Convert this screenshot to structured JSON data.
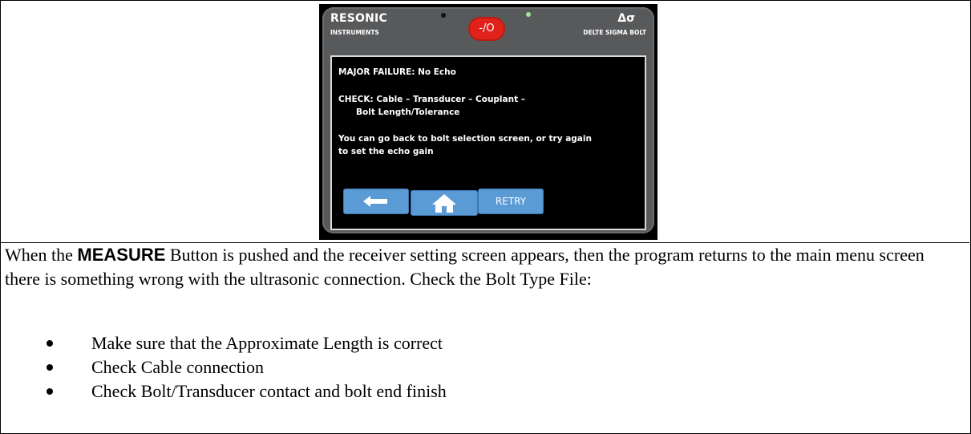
{
  "device": {
    "brand_name": "RESONIC",
    "brand_sub": "INSTRUMENTS",
    "model_symbol": "Δσ",
    "model_sub": "DELTE SIGMA BOLT",
    "power_label": "-/O",
    "screen": {
      "line1": "MAJOR FAILURE: No Echo",
      "line2": "CHECK: Cable – Transducer – Couplant –",
      "line3": "Bolt Length/Tolerance",
      "line4": "You can go back to bolt selection screen, or try again",
      "line5": "to set the echo gain"
    },
    "buttons": {
      "back_icon": "left-arrow-icon",
      "home_icon": "home-icon",
      "retry_label": "RETRY"
    },
    "colors": {
      "power": "#e0221a",
      "button": "#5b9bd5",
      "led_on": "#a7e3a0"
    }
  },
  "instructions": {
    "intro_before": "When the ",
    "intro_emphasis": "MEASURE",
    "intro_after": " Button is pushed and the receiver setting screen appears, then the program returns to the main menu screen there is something wrong with the ultrasonic connection. Check the Bolt Type File:",
    "bullets": [
      "Make sure that the Approximate Length is correct",
      "Check Cable connection",
      "Check Bolt/Transducer contact and bolt end finish"
    ]
  }
}
